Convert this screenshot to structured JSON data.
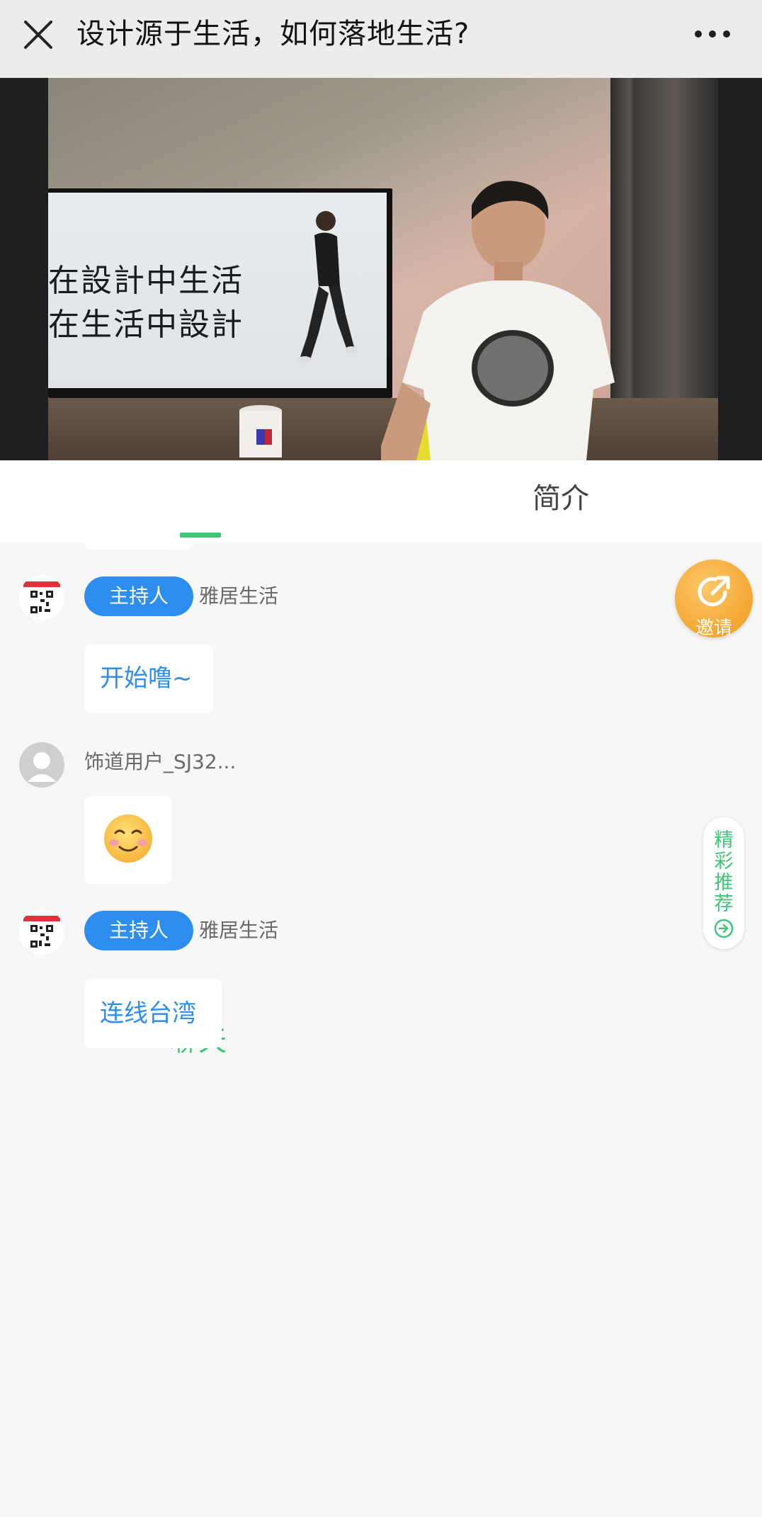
{
  "header": {
    "title": "设计源于生活，如何落地生活?",
    "close_icon": "close-icon",
    "more_icon": "more-dots-icon"
  },
  "video": {
    "tv_text_line1": "在設計中生活",
    "tv_text_line2": "在生活中設計"
  },
  "tabs": [
    {
      "label": "聊天",
      "active": true
    },
    {
      "label": "简介",
      "active": false
    }
  ],
  "colors": {
    "accent_green": "#3cc676",
    "host_blue": "#2e8ef0",
    "invite_orange": "#f5a935"
  },
  "messages": [
    {
      "role": "主持人",
      "name": "雅居生活",
      "text": "开始噜~",
      "avatar": "brand-avatar"
    },
    {
      "role": "",
      "name": "饰道用户_SJ32...",
      "text": "",
      "emoji": "smiling-face-emoji",
      "avatar": "default-user-avatar"
    },
    {
      "role": "主持人",
      "name": "雅居生活",
      "text": "连线台湾",
      "avatar": "brand-avatar"
    }
  ],
  "floating": {
    "invite_label": "邀请",
    "recommend_label": "精彩推荐"
  }
}
